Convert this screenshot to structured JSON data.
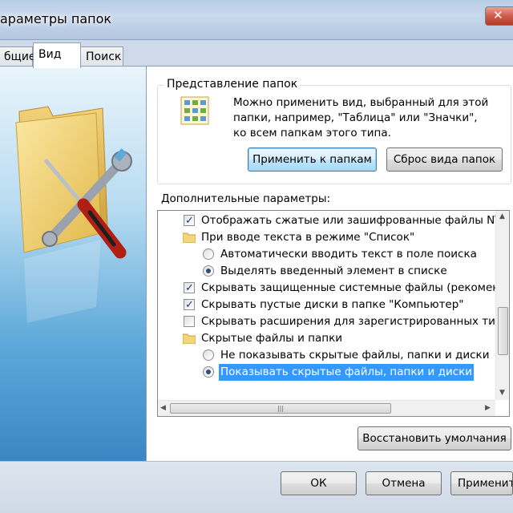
{
  "window": {
    "title": "араметры папок"
  },
  "tabs": [
    {
      "label": "бщие"
    },
    {
      "label": "Вид"
    },
    {
      "label": "Поиск"
    }
  ],
  "folder_views": {
    "group_title": "Представление папок",
    "description": "Можно применить вид, выбранный для этой папки, например, \"Таблица\" или \"Значки\", ко всем папкам этого типа.",
    "apply_button": "Применить к папкам",
    "reset_button": "Сброс вида папок"
  },
  "advanced": {
    "label": "Дополнительные параметры:",
    "items": [
      {
        "type": "checkbox",
        "checked": true,
        "label": "Отображать сжатые или зашифрованные файлы NTFS"
      },
      {
        "type": "folder",
        "label": "При вводе текста в режиме \"Список\""
      },
      {
        "type": "radio",
        "checked": false,
        "label": "Автоматически вводить текст в поле поиска"
      },
      {
        "type": "radio",
        "checked": true,
        "label": "Выделять введенный элемент в списке"
      },
      {
        "type": "checkbox",
        "checked": true,
        "label": "Скрывать защищенные системные файлы (рекоменду"
      },
      {
        "type": "checkbox",
        "checked": true,
        "label": "Скрывать пустые диски в папке \"Компьютер\""
      },
      {
        "type": "checkbox",
        "checked": false,
        "label": "Скрывать расширения для зарегистрированных типов"
      },
      {
        "type": "folder",
        "label": "Скрытые файлы и папки"
      },
      {
        "type": "radio",
        "checked": false,
        "label": "Не показывать скрытые файлы, папки и диски"
      },
      {
        "type": "radio",
        "checked": true,
        "selected": true,
        "label": "Показывать скрытые файлы, папки и диски"
      }
    ],
    "restore_button": "Восстановить умолчания"
  },
  "footer": {
    "ok": "ОК",
    "cancel": "Отмена",
    "apply": "Применит"
  },
  "colors": {
    "selection": "#3399ff",
    "focus_border": "#3c7fb1"
  },
  "icons": [
    "close-icon",
    "folder-tools-icon",
    "folder-view-grid-icon",
    "folder-icon",
    "checkbox",
    "radio"
  ]
}
